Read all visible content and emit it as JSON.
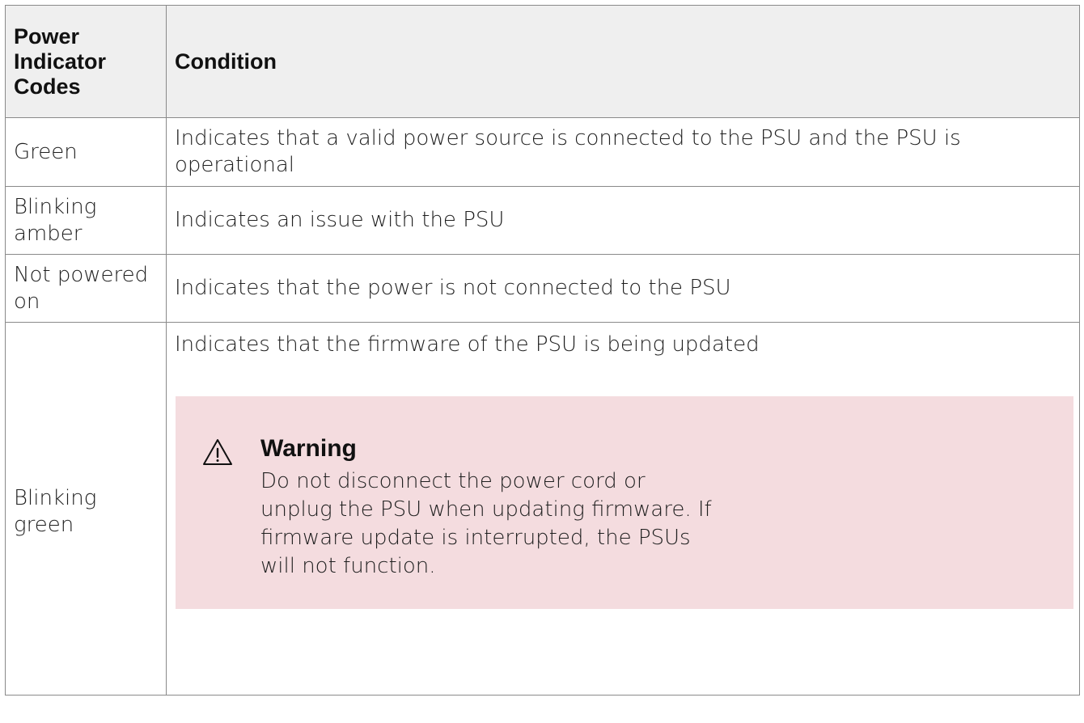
{
  "table": {
    "headers": {
      "code": "Power Indicator Codes",
      "condition": "Condition"
    },
    "rows": [
      {
        "code": "Green",
        "condition": "Indicates that a valid power source is connected to the PSU and the PSU is operational"
      },
      {
        "code": "Blinking amber",
        "condition": "Indicates an issue with the PSU"
      },
      {
        "code": "Not powered on",
        "condition": "Indicates that the power is not connected to the PSU"
      },
      {
        "code": "Blinking green",
        "condition": "Indicates that the firmware of the PSU is being updated",
        "warning": {
          "icon": "warning-triangle-icon",
          "title": "Warning",
          "text": "Do not disconnect the power cord or unplug the PSU when updating firmware. If firmware update is interrupted, the PSUs will not function."
        }
      }
    ]
  },
  "colors": {
    "header_bg": "#efefef",
    "warning_bg": "#f4dcdf",
    "border": "#8a8a8a"
  }
}
